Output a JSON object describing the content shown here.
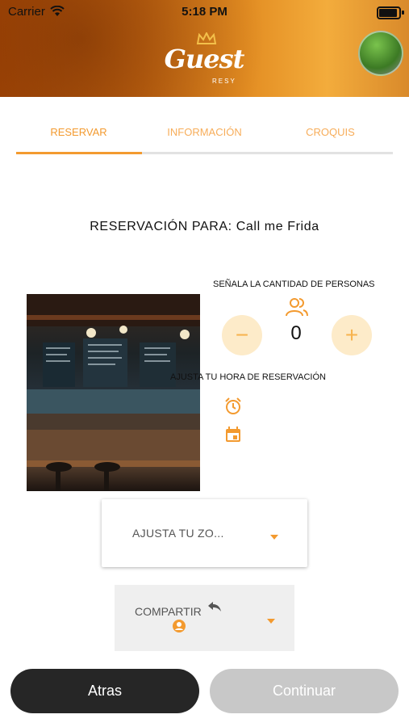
{
  "status_bar": {
    "carrier": "Carrier",
    "time": "5:18 PM"
  },
  "header": {
    "logo_text": "Guest",
    "logo_sub": "RESY"
  },
  "tabs": [
    {
      "label": "RESERVAR",
      "active": true
    },
    {
      "label": "INFORMACIÓN",
      "active": false
    },
    {
      "label": "CROQUIS",
      "active": false
    }
  ],
  "reservation": {
    "title": "RESERVACIÓN PARA: Call me Frida",
    "people_label": "SEÑALA LA CANTIDAD DE PERSONAS",
    "people_count": "0",
    "minus_symbol": "−",
    "plus_symbol": "+",
    "time_label": "AJUSTA TU HORA DE RESERVACIÓN"
  },
  "zone_select": {
    "value": "AJUSTA TU ZO..."
  },
  "share": {
    "label": "COMPARTIR"
  },
  "buttons": {
    "back": "Atras",
    "next": "Continuar"
  },
  "colors": {
    "accent": "#f39a2f",
    "light_accent": "#fdebc9",
    "dark_button": "#262626",
    "disabled_button": "#c8c8c8"
  },
  "icons": [
    "wifi-icon",
    "battery-icon",
    "crown-icon",
    "people-icon",
    "alarm-icon",
    "calendar-icon",
    "caret-down-icon",
    "reply-icon",
    "account-icon"
  ]
}
